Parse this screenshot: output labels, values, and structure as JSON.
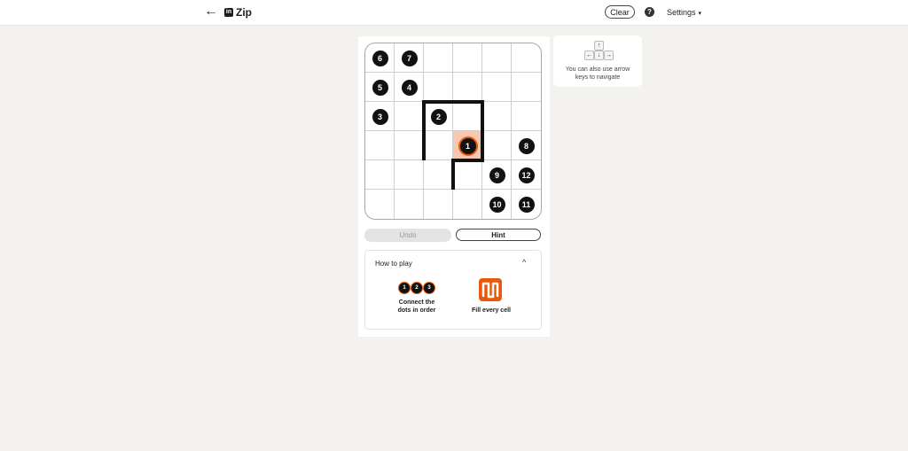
{
  "header": {
    "title": "Zip",
    "logo_text": "in",
    "back_icon": "←",
    "clear_label": "Clear",
    "help_icon": "?",
    "settings_label": "Settings",
    "settings_caret": "▾"
  },
  "board": {
    "rows": 6,
    "cols": 6,
    "highlighted_cell": [
      3,
      3
    ],
    "dots": [
      {
        "label": "6",
        "row": 0,
        "col": 0
      },
      {
        "label": "7",
        "row": 0,
        "col": 1
      },
      {
        "label": "5",
        "row": 1,
        "col": 0
      },
      {
        "label": "4",
        "row": 1,
        "col": 1
      },
      {
        "label": "3",
        "row": 2,
        "col": 0
      },
      {
        "label": "2",
        "row": 2,
        "col": 2
      },
      {
        "label": "1",
        "row": 3,
        "col": 3,
        "active": true
      },
      {
        "label": "8",
        "row": 3,
        "col": 5
      },
      {
        "label": "9",
        "row": 4,
        "col": 4
      },
      {
        "label": "12",
        "row": 4,
        "col": 5
      },
      {
        "label": "10",
        "row": 5,
        "col": 4
      },
      {
        "label": "11",
        "row": 5,
        "col": 5
      }
    ],
    "path_color": "#111111",
    "highlight_color": "#f6c7b1",
    "accent_color": "#e8590c"
  },
  "controls": {
    "undo_label": "Undo",
    "hint_label": "Hint"
  },
  "how_to_play": {
    "title": "How to play",
    "collapse_icon": "^",
    "mini_dots": [
      "1",
      "2",
      "3"
    ],
    "caption_connect": "Connect the dots in order",
    "caption_fill": "Fill every cell"
  },
  "tip": {
    "keys": [
      "↑",
      "←",
      "↓",
      "→"
    ],
    "text": "You can also use arrow keys to navigate"
  }
}
